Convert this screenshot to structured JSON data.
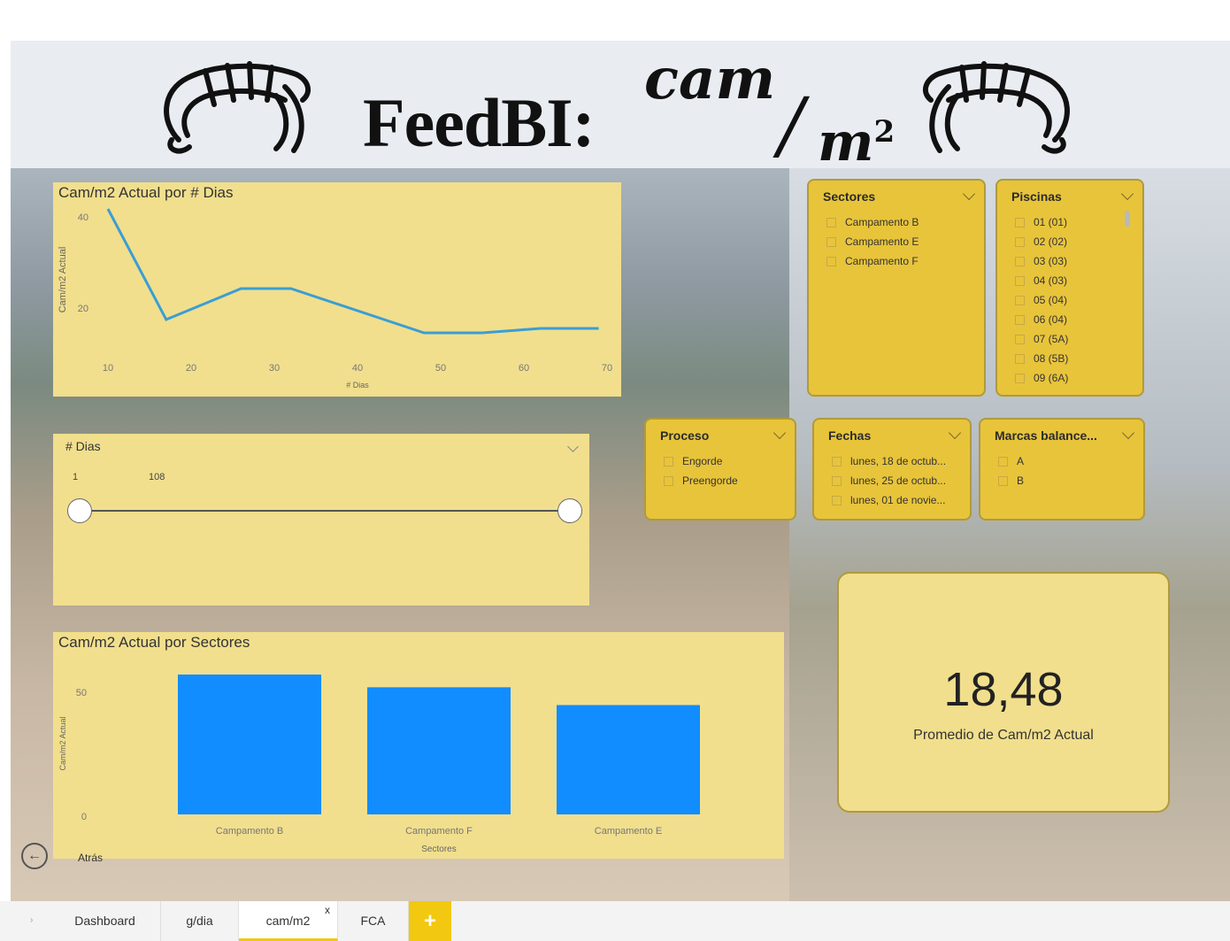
{
  "banner": {
    "title": "FeedBI:",
    "numerator": "cam",
    "denominator": "m",
    "exponent": "2"
  },
  "line_chart": {
    "title": "Cam/m2 Actual por # Dias",
    "ylabel": "Cam/m2 Actual",
    "xlabel": "# Dias",
    "x_ticks": [
      "10",
      "20",
      "30",
      "40",
      "50",
      "60",
      "70"
    ],
    "y_ticks": [
      "40",
      "20"
    ]
  },
  "days_slicer": {
    "title": "# Dias",
    "min": "1",
    "max": "108"
  },
  "bar_chart": {
    "title": "Cam/m2 Actual por Sectores",
    "ylabel": "Cam/m2 Actual",
    "xlabel": "Sectores",
    "y_ticks": [
      "50",
      "0"
    ],
    "categories": [
      "Campamento B",
      "Campamento F",
      "Campamento E"
    ]
  },
  "sectores_slicer": {
    "title": "Sectores",
    "items": [
      "Campamento B",
      "Campamento E",
      "Campamento F"
    ]
  },
  "piscinas_slicer": {
    "title": "Piscinas",
    "items": [
      "01 (01)",
      "02 (02)",
      "03 (03)",
      "04 (03)",
      "05 (04)",
      "06 (04)",
      "07 (5A)",
      "08 (5B)",
      "09 (6A)"
    ]
  },
  "proceso_slicer": {
    "title": "Proceso",
    "items": [
      "Engorde",
      "Preengorde"
    ]
  },
  "fechas_slicer": {
    "title": "Fechas",
    "items": [
      "lunes, 18 de octub...",
      "lunes, 25 de octub...",
      "lunes, 01 de novie..."
    ]
  },
  "marcas_slicer": {
    "title": "Marcas balance...",
    "items": [
      "A",
      "B"
    ]
  },
  "kpi_card": {
    "value": "18,48",
    "label": "Promedio de Cam/m2 Actual"
  },
  "back_button": {
    "label": "Atrás"
  },
  "tabs": [
    {
      "label": "Dashboard"
    },
    {
      "label": "g/dia"
    },
    {
      "label": "cam/m2"
    },
    {
      "label": "FCA"
    }
  ],
  "add_tab_label": "+",
  "close_tab_label": "x",
  "colors": {
    "panel": "#f1df8d",
    "slicer": "#e8c43b",
    "line": "#3a9ed4",
    "bar": "#118dff",
    "tab_accent": "#f2c811"
  },
  "chart_data": [
    {
      "type": "line",
      "title": "Cam/m2 Actual por # Dias",
      "xlabel": "# Dias",
      "ylabel": "Cam/m2 Actual",
      "x": [
        10,
        17,
        26,
        32,
        48,
        55,
        62,
        69
      ],
      "series": [
        {
          "values": [
            40,
            15,
            22,
            22,
            12,
            12,
            13,
            13
          ]
        }
      ],
      "xlim": [
        8,
        70
      ],
      "ylim": [
        6,
        42
      ],
      "grid": false
    },
    {
      "type": "bar",
      "title": "Cam/m2 Actual por Sectores",
      "xlabel": "Sectores",
      "ylabel": "Cam/m2 Actual",
      "categories": [
        "Campamento B",
        "Campamento F",
        "Campamento E"
      ],
      "values": [
        55,
        50,
        43
      ],
      "ylim": [
        0,
        55
      ],
      "grid": false
    }
  ]
}
